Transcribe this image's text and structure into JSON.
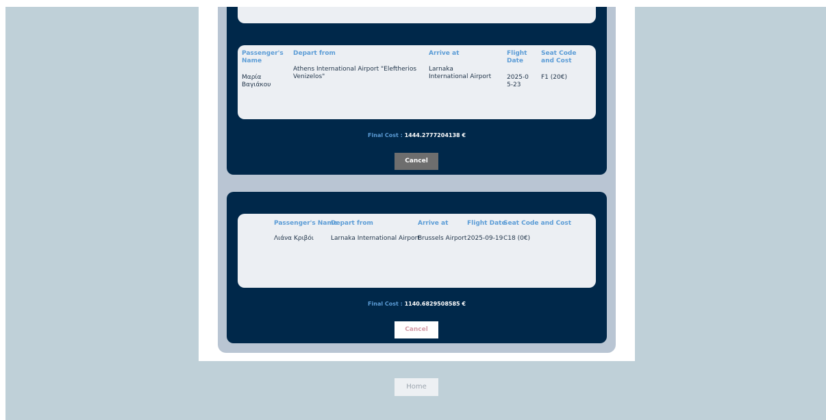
{
  "bookings": [
    {
      "headers": {
        "passenger": "Passenger's Name",
        "depart": "Depart from",
        "arrive": "Arrive at",
        "date": "Flight Date",
        "seat": "Seat Code and Cost"
      },
      "row": {
        "passenger": "Μαρία Βαγιάκου",
        "depart": "Athens International Airport \"Eleftherios Venizelos\"",
        "arrive": "Larnaka International Airport",
        "date": "2025-05-23",
        "seat": "F1 (20€)"
      },
      "final_cost_label": "Final Cost :",
      "final_cost_value": "1444.2777204138 €",
      "cancel_label": "Cancel"
    },
    {
      "headers": {
        "passenger": "Passenger's Name",
        "depart": "Depart from",
        "arrive": "Arrive at",
        "date": "Flight Date",
        "seat": "Seat Code and Cost"
      },
      "row": {
        "passenger": "Λιάνα Κριβόι",
        "depart": "Larnaka International Airport",
        "arrive": "Brussels Airport",
        "date": "2025-09-19",
        "seat": "C18 (0€)"
      },
      "final_cost_label": "Final Cost :",
      "final_cost_value": "1140.6829508585 €",
      "cancel_label": "Cancel"
    }
  ],
  "home_label": "Home",
  "colors": {
    "page_background": "#bfd0d8",
    "card_navy": "#00284a",
    "header_blue": "#5b9cd6",
    "ticket_box": "#eceff3"
  }
}
